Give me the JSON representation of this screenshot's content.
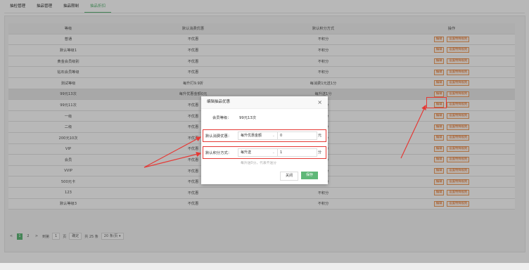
{
  "tabs": [
    "抽检管理",
    "抽品管理",
    "抽品限制",
    "抽品折扣"
  ],
  "table": {
    "headers": [
      "等级",
      "默认消费优惠",
      "默认积分方式",
      "操作"
    ],
    "rows": [
      [
        "普通",
        "不优惠",
        "不积分"
      ],
      [
        "默认等级1",
        "不优惠",
        "不积分"
      ],
      [
        "黄金会员级别",
        "不优惠",
        "不积分"
      ],
      [
        "钻石会员等级",
        "不优惠",
        "不积分"
      ],
      [
        "测试等级",
        "每升打9.9折",
        "每消费1元送1分"
      ],
      [
        "99元13次",
        "每升优惠金额0元",
        "每升送1分"
      ],
      [
        "99元11次",
        "不优惠",
        "不积分"
      ],
      [
        "一级",
        "不优惠",
        "不积分"
      ],
      [
        "二级",
        "不优惠",
        "不积分"
      ],
      [
        "200元10次",
        "不优惠",
        "不积分"
      ],
      [
        "VIP",
        "不优惠",
        "不积分"
      ],
      [
        "会员",
        "不优惠",
        "不积分"
      ],
      [
        "VVIP",
        "不优惠",
        "不积分"
      ],
      [
        "500元卡",
        "不优惠",
        "不积分"
      ],
      [
        "123",
        "不优惠",
        "不积分"
      ],
      [
        "默认等级3",
        "不优惠",
        "不积分"
      ]
    ],
    "edit_label": "编辑",
    "special_label": "设置特殊规则"
  },
  "pager": {
    "prev": "<",
    "pages": [
      "1",
      "2"
    ],
    "next": ">",
    "goto_label": "到第",
    "goto_value": "1",
    "page_unit": "页",
    "confirm": "确定",
    "total": "共 25 条",
    "per_page": "20 条/页"
  },
  "modal": {
    "title": "编辑抽品优惠",
    "close_glyph": "×",
    "level_label": "会员等级：",
    "level_value": "99元13次",
    "discount_label": "默认消费优惠：",
    "discount_type": "每升优惠金额",
    "discount_value": "0",
    "discount_unit": "元",
    "points_label": "默认积分方式：",
    "points_type": "每升送",
    "points_value": "1",
    "points_unit": "分",
    "hint": "每升送0分，代表不送分",
    "close_button": "关闭",
    "save_button": "保存"
  },
  "colors": {
    "accent": "#5fb878",
    "highlight": "#e53935",
    "op_button": "#e8742a"
  }
}
